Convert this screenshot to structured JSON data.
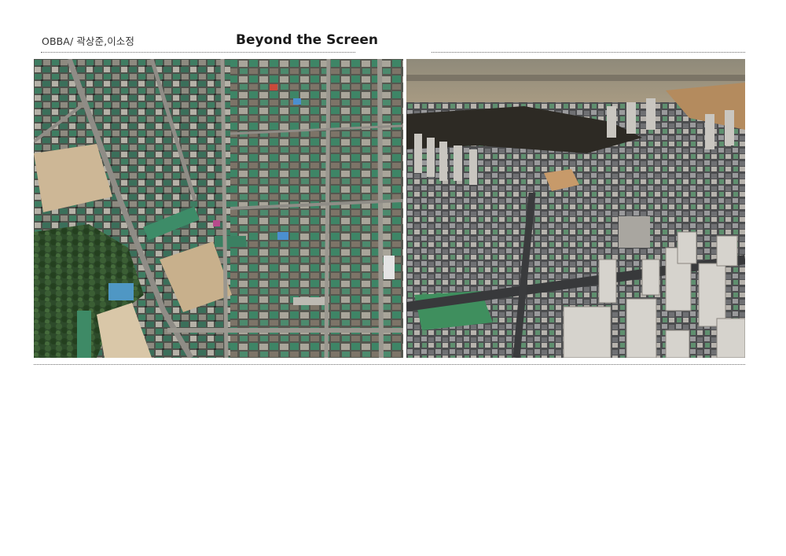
{
  "header": {
    "author": "OBBA/ 곽상준,이소정",
    "title": "Beyond the Screen"
  },
  "photos": [
    {
      "name": "aerial-top-down-view"
    },
    {
      "name": "aerial-oblique-view"
    }
  ]
}
